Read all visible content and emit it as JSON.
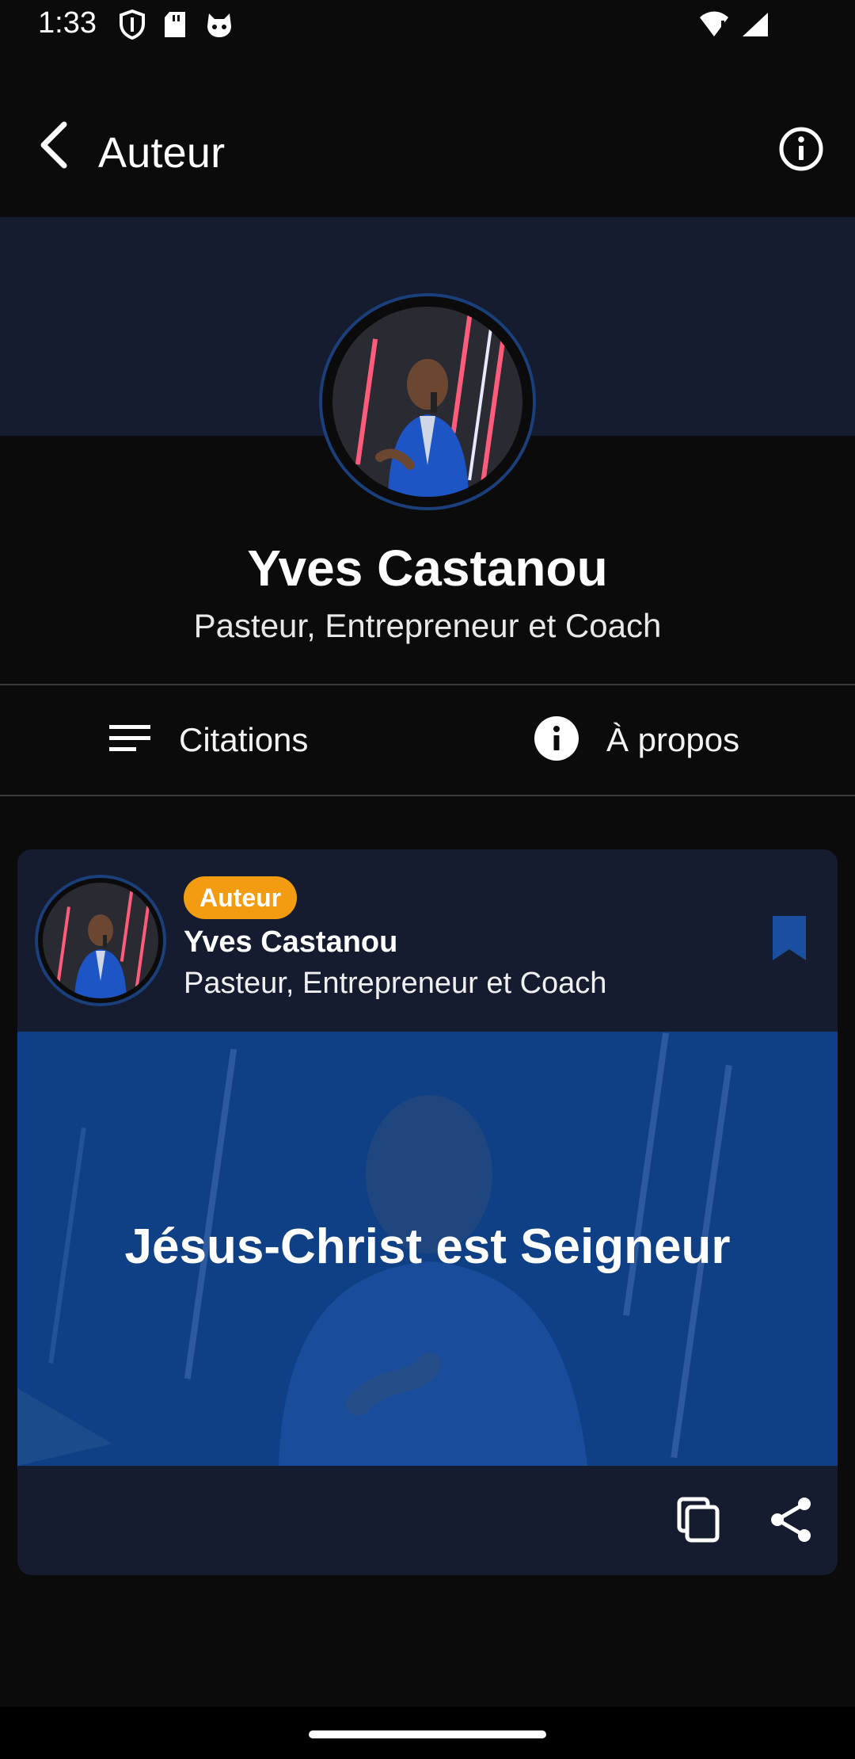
{
  "status_bar": {
    "time": "1:33",
    "left_icons": [
      "shield-icon",
      "sd-card-icon",
      "cat-icon"
    ],
    "right_icons": [
      "wifi-icon",
      "signal-icon"
    ]
  },
  "app_bar": {
    "title": "Auteur",
    "back_icon": "back-arrow-icon",
    "info_icon": "info-circle-icon"
  },
  "profile": {
    "name": "Yves Castanou",
    "role": "Pasteur, Entrepreneur et Coach"
  },
  "tabs": [
    {
      "label": "Citations",
      "icon": "list-icon"
    },
    {
      "label": "À propos",
      "icon": "info-filled-icon"
    }
  ],
  "quote_card": {
    "badge": "Auteur",
    "author_name": "Yves Castanou",
    "author_role": "Pasteur, Entrepreneur et Coach",
    "quote": "Jésus-Christ est Seigneur",
    "actions": [
      "copy-icon",
      "share-icon"
    ]
  },
  "colors": {
    "background": "#0b0b0b",
    "card": "#151c2f",
    "quote_bg": "#0f3f85",
    "badge": "#f39c12",
    "bookmark": "#1a4fa0"
  }
}
